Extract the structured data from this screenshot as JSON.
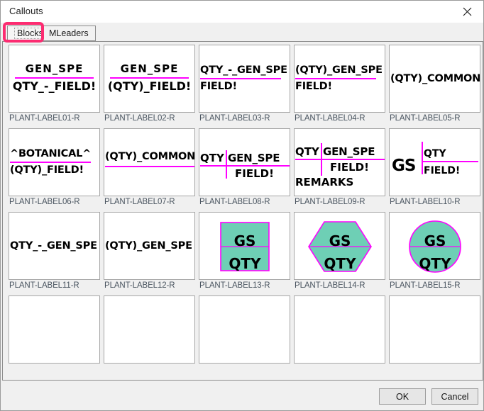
{
  "window": {
    "title": "Callouts",
    "close_icon": "close-icon"
  },
  "tabs": [
    {
      "id": "blocks",
      "label": "Blocks",
      "selected": true,
      "highlighted": true
    },
    {
      "id": "mleaders",
      "label": "MLeaders",
      "selected": false,
      "highlighted": false
    }
  ],
  "highlight": {
    "color": "#fc2c71",
    "target": "Blocks"
  },
  "colors": {
    "accent_magenta": "#ff00ff",
    "shape_fill_teal": "#6ecfb5",
    "label_text": "#4a5560",
    "panel_bg": "#f0f0f0",
    "cell_bg": "#ffffff",
    "highlight_pink": "#fc2c71"
  },
  "blocks": [
    {
      "name": "PLANT-LABEL01-R",
      "layout": "stack-center",
      "lines": [
        "GEN_SPE",
        "QTY_-_FIELD!"
      ],
      "rule": "horizontal-center"
    },
    {
      "name": "PLANT-LABEL02-R",
      "layout": "stack-center",
      "lines": [
        "GEN_SPE",
        "(QTY)_FIELD!"
      ],
      "rule": "horizontal-center"
    },
    {
      "name": "PLANT-LABEL03-R",
      "layout": "stack-left",
      "lines": [
        "QTY_-_GEN_SPE",
        "FIELD!"
      ],
      "rule": "horizontal-left"
    },
    {
      "name": "PLANT-LABEL04-R",
      "layout": "stack-left",
      "lines": [
        "(QTY)_GEN_SPE",
        "FIELD!"
      ],
      "rule": "horizontal-left"
    },
    {
      "name": "PLANT-LABEL05-R",
      "layout": "single-left",
      "lines": [
        "(QTY)_COMMON"
      ],
      "rule": "none"
    },
    {
      "name": "PLANT-LABEL06-R",
      "layout": "stack-left",
      "lines": [
        "^BOTANICAL^",
        "(QTY)_FIELD!"
      ],
      "rule": "horizontal-left"
    },
    {
      "name": "PLANT-LABEL07-R",
      "layout": "single-underline",
      "lines": [
        "(QTY)_COMMON"
      ],
      "rule": "horizontal-under"
    },
    {
      "name": "PLANT-LABEL08-R",
      "layout": "leader-right",
      "lines": [
        "QTY",
        "GEN_SPE",
        "FIELD!"
      ],
      "rule": "cross"
    },
    {
      "name": "PLANT-LABEL09-R",
      "layout": "leader-right-3",
      "lines": [
        "QTY",
        "GEN_SPE",
        "FIELD!",
        "REMARKS"
      ],
      "rule": "cross"
    },
    {
      "name": "PLANT-LABEL10-R",
      "layout": "gs-leader",
      "lines": [
        "GS",
        "QTY",
        "FIELD!"
      ],
      "rule": "tee"
    },
    {
      "name": "PLANT-LABEL11-R",
      "layout": "single-left",
      "lines": [
        "QTY_-_GEN_SPE"
      ],
      "rule": "none"
    },
    {
      "name": "PLANT-LABEL12-R",
      "layout": "single-left",
      "lines": [
        "(QTY)_GEN_SPE"
      ],
      "rule": "none"
    },
    {
      "name": "PLANT-LABEL13-R",
      "layout": "shape-rect",
      "lines": [
        "GS",
        "QTY"
      ],
      "shape": "rectangle"
    },
    {
      "name": "PLANT-LABEL14-R",
      "layout": "shape-hex",
      "lines": [
        "GS",
        "QTY"
      ],
      "shape": "hexagon"
    },
    {
      "name": "PLANT-LABEL15-R",
      "layout": "shape-circle",
      "lines": [
        "GS",
        "QTY"
      ],
      "shape": "circle"
    },
    {
      "name": "",
      "layout": "empty",
      "lines": []
    },
    {
      "name": "",
      "layout": "empty",
      "lines": []
    },
    {
      "name": "",
      "layout": "empty",
      "lines": []
    },
    {
      "name": "",
      "layout": "empty",
      "lines": []
    },
    {
      "name": "",
      "layout": "empty",
      "lines": []
    }
  ],
  "footer": {
    "ok_label": "OK",
    "cancel_label": "Cancel"
  }
}
